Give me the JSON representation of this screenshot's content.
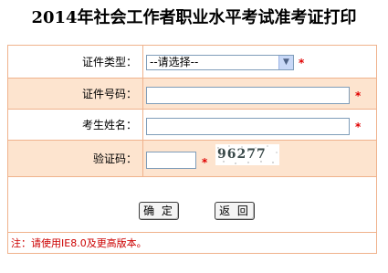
{
  "page": {
    "title": "2014年社会工作者职业水平考试准考证打印"
  },
  "form": {
    "id_type": {
      "label": "证件类型：",
      "selected": "--请选择--"
    },
    "id_number": {
      "label": "证件号码：",
      "value": ""
    },
    "name": {
      "label": "考生姓名：",
      "value": ""
    },
    "captcha": {
      "label": "验证码：",
      "value": "",
      "image_text": "96277"
    },
    "required_mark": "*",
    "buttons": {
      "confirm": "确 定",
      "back": "返 回"
    },
    "note": "注：请使用IE8.0及更高版本。"
  },
  "colors": {
    "border": "#f0b28c",
    "alt_row": "#fde4cf",
    "required": "#e00000",
    "note": "#cc0000"
  }
}
